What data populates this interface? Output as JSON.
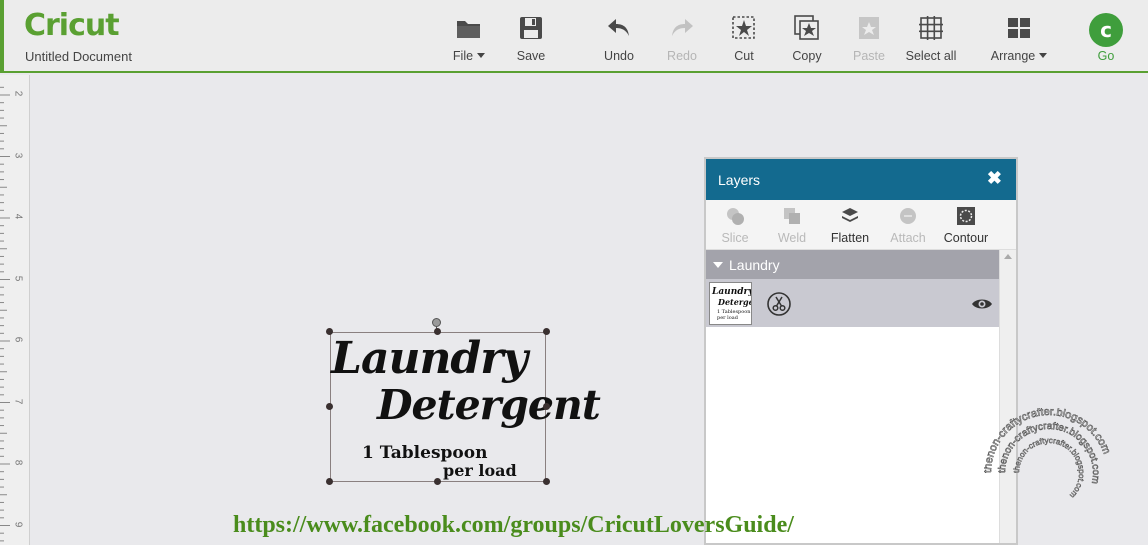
{
  "app": {
    "logo_text": "Cricut",
    "document_title": "Untitled Document"
  },
  "toolbar": [
    {
      "id": "file",
      "label": "File",
      "icon": "folder-icon",
      "has_dropdown": true,
      "disabled": false
    },
    {
      "id": "save",
      "label": "Save",
      "icon": "save-icon",
      "disabled": false
    },
    {
      "id": "undo",
      "label": "Undo",
      "icon": "undo-icon",
      "disabled": false
    },
    {
      "id": "redo",
      "label": "Redo",
      "icon": "redo-icon",
      "disabled": true
    },
    {
      "id": "cut",
      "label": "Cut",
      "icon": "cut-icon",
      "disabled": false
    },
    {
      "id": "copy",
      "label": "Copy",
      "icon": "copy-icon",
      "disabled": false
    },
    {
      "id": "paste",
      "label": "Paste",
      "icon": "paste-icon",
      "disabled": true
    },
    {
      "id": "select_all",
      "label": "Select all",
      "icon": "select-all-icon",
      "disabled": false
    },
    {
      "id": "arrange",
      "label": "Arrange",
      "icon": "arrange-icon",
      "has_dropdown": true,
      "disabled": false
    }
  ],
  "go": {
    "label": "Go",
    "glyph": "c"
  },
  "ruler": {
    "numbers": [
      "2",
      "3",
      "4",
      "5",
      "6",
      "7",
      "8",
      "9"
    ]
  },
  "design": {
    "line1": "Laundry",
    "line2": "Detergent",
    "line3": "1 Tablespoon",
    "line4": "per load"
  },
  "layers": {
    "title": "Layers",
    "close_glyph": "✖",
    "tools": [
      {
        "label": "Slice",
        "icon": "slice-icon",
        "disabled": true
      },
      {
        "label": "Weld",
        "icon": "weld-icon",
        "disabled": true
      },
      {
        "label": "Flatten",
        "icon": "flatten-icon",
        "disabled": false
      },
      {
        "label": "Attach",
        "icon": "attach-icon",
        "disabled": true
      },
      {
        "label": "Contour",
        "icon": "contour-icon",
        "disabled": false
      }
    ],
    "group_name": "Laundry",
    "thumb": {
      "line1": "Laundry",
      "line2": "Detergent",
      "line3": "1 Tablespoon per load"
    }
  },
  "footer_link": "https://www.facebook.com/groups/CricutLoversGuide/",
  "watermark": {
    "text": "thenon-craftycrafter.blogspot.com "
  },
  "colors": {
    "brand_green": "#5aa032",
    "layers_header": "#136a8f",
    "go_green": "#3f9e3c",
    "link_green": "#4a8c1c"
  }
}
